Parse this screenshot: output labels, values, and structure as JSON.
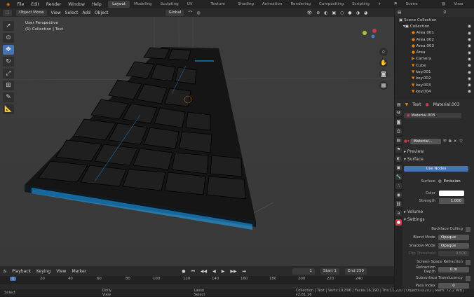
{
  "menu": [
    "File",
    "Edit",
    "Render",
    "Window",
    "Help"
  ],
  "workspaces": [
    "Layout",
    "Modeling",
    "Sculpting",
    "UV Editing",
    "Texture Paint",
    "Shading",
    "Animation",
    "Rendering",
    "Compositing",
    "Scripting"
  ],
  "scene_label": "Scene",
  "view_layer_label": "View Layer",
  "viewport": {
    "mode": "Object Mode",
    "menus": [
      "View",
      "Select",
      "Add",
      "Object"
    ],
    "transform": "Global",
    "overlay_title": "User Perspective",
    "overlay_sub": "(1) Collection | Text"
  },
  "timeline": {
    "menus": [
      "Playback",
      "Keying",
      "View",
      "Marker"
    ],
    "current": "1",
    "start_label": "Start",
    "start": "1",
    "end_label": "End",
    "end": "250",
    "ticks": [
      "1",
      "20",
      "40",
      "60",
      "80",
      "100",
      "120",
      "140",
      "160",
      "180",
      "200",
      "220",
      "240"
    ]
  },
  "status": {
    "select": "Select",
    "dolly": "Dolly View",
    "lasso": "Lasso Select",
    "info": "Collection | Text | Verts:19,896 | Faces:16,190 | Tris:11,220 | Objects:0/202 | Mem: 72.2 MiB | v2.81.16"
  },
  "outliner": {
    "root": "Scene Collection",
    "collection": "Collection",
    "items": [
      "Area.001",
      "Area.002",
      "Area.003",
      "Area",
      "Camera",
      "Cube",
      "key.001",
      "key.002",
      "key.003",
      "key.004"
    ]
  },
  "props": {
    "object": "Text",
    "material": "Material.003",
    "slot": "Material.003",
    "mat_name": "Material...",
    "preview": "Preview",
    "surface_sec": "Surface",
    "use_nodes": "Use Nodes",
    "surface_label": "Surface",
    "surface_val": "Emission",
    "color_label": "Color",
    "strength_label": "Strength",
    "strength": "1.000",
    "volume": "Volume",
    "settings": "Settings",
    "backface": "Backface Culling",
    "blend_label": "Blend Mode",
    "blend": "Opaque",
    "shadow_label": "Shadow Mode",
    "shadow": "Opaque",
    "clip_label": "Clip Threshold",
    "clip": "0.500",
    "ssr": "Screen Space Refraction",
    "refr_label": "Refraction Depth",
    "refr": "0 m",
    "sst": "Subsurface Translucency",
    "pass_label": "Pass Index",
    "pass": "0"
  },
  "colors": {
    "accent": "#4772b3",
    "glow": "#1fa9ff"
  }
}
